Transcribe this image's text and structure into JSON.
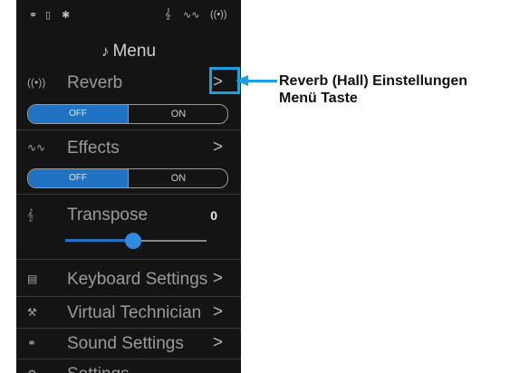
{
  "status_bar": {
    "headphones_icon": "headphones-icon",
    "usb_icon": "usb-icon",
    "bluetooth_icon": "bluetooth-icon",
    "transpose_icon": "treble-clef-icon",
    "effects_icon": "effects-wave-icon",
    "reverb_icon": "reverb-waves-icon"
  },
  "menu": {
    "title": "Menu",
    "items": [
      {
        "label": "Reverb",
        "icon": "reverb-waves-icon",
        "chevron": ">"
      },
      {
        "label": "Effects",
        "icon": "effects-wave-icon",
        "chevron": ">"
      },
      {
        "label": "Transpose",
        "icon": "treble-clef-icon",
        "value": "0"
      },
      {
        "label": "Keyboard Settings",
        "icon": "keyboard-icon",
        "chevron": ">"
      },
      {
        "label": "Virtual Technician",
        "icon": "technician-icon",
        "chevron": ">"
      },
      {
        "label": "Sound Settings",
        "icon": "headphones-icon",
        "chevron": ">"
      },
      {
        "label": "Settings",
        "icon": "gear-icon"
      }
    ],
    "reverb_toggle": {
      "off": "OFF",
      "on": "ON",
      "selected": "OFF"
    },
    "effects_toggle": {
      "off": "OFF",
      "on": "ON",
      "selected": "OFF"
    },
    "transpose_slider": {
      "value": 0
    }
  },
  "callout": {
    "line1": "Reverb (Hall) Einstellungen",
    "line2": "Menü Taste"
  },
  "colors": {
    "accent": "#1f73c2",
    "highlight": "#1aa0e0",
    "background": "#141414"
  }
}
